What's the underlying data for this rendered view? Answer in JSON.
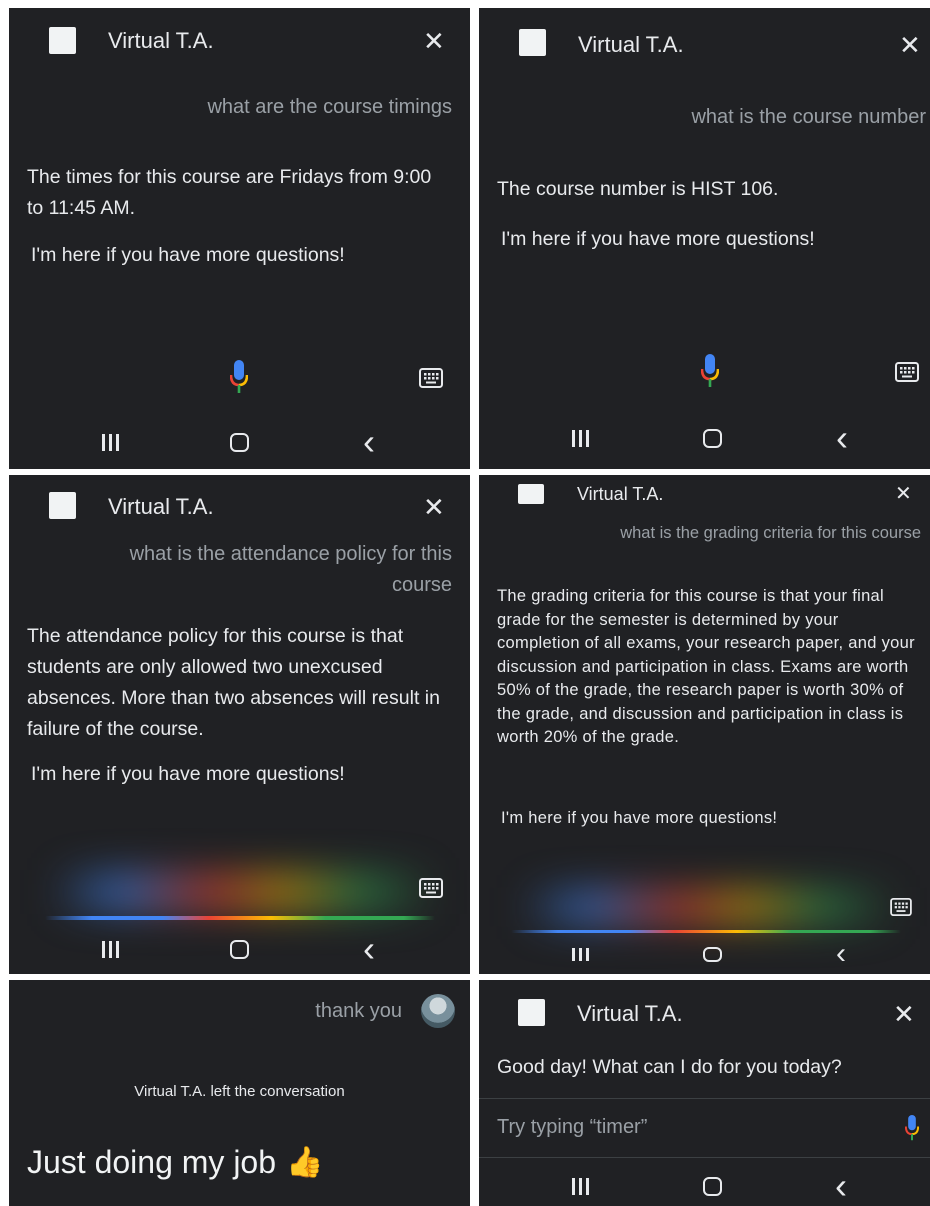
{
  "app": {
    "title": "Virtual T.A.",
    "close_glyph": "✕"
  },
  "colors": {
    "panel_bg": "#202124",
    "text": "#e8eaed",
    "muted": "#9aa0a6",
    "google_blue": "#4285f4",
    "google_red": "#ea4335",
    "google_yellow": "#fbbc04",
    "google_green": "#34a853"
  },
  "icons": [
    "app-icon",
    "close-icon",
    "mic-icon",
    "keyboard-icon",
    "recent-apps-icon",
    "home-icon",
    "back-icon",
    "avatar",
    "thumbs-up-icon"
  ],
  "screens": [
    {
      "query": "what are the course timings",
      "answer": "The times for this course are Fridays from 9:00 to 11:45 AM.",
      "followup": "I'm here if you have more questions!"
    },
    {
      "query": "what is the course number",
      "answer": "The course number is HIST 106.",
      "followup": "I'm here if you have more questions!"
    },
    {
      "query": "what is the attendance policy for this course",
      "answer": "The attendance policy for this course is that students are only allowed two unexcused absences. More than two absences will result in failure of the course.",
      "followup": "I'm here if you have more questions!"
    },
    {
      "query": "what is the grading criteria for this course",
      "answer": "The grading criteria for this course is that your final grade for the semester is determined by your completion of all exams, your research paper, and your discussion and participation in class. Exams are worth 50% of the grade, the research paper is worth 30% of the grade, and discussion and participation in class is worth 20% of the grade.",
      "followup": "I'm here if you have more questions!"
    },
    {
      "user_message": "thank you",
      "system_note": "Virtual T.A. left the conversation",
      "reply": "Just doing my job",
      "reply_emoji": "👍"
    },
    {
      "greeting": "Good day! What can I do for you today?",
      "input_placeholder": "Try typing “timer”"
    }
  ],
  "nav": {
    "back_glyph": "‹"
  }
}
